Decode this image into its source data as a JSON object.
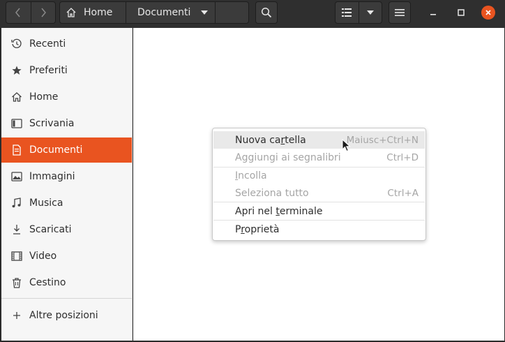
{
  "header": {
    "breadcrumb": {
      "home": "Home",
      "current": "Documenti"
    },
    "icons": {
      "back": "chevron-left-icon",
      "forward": "chevron-right-icon",
      "home": "home-icon",
      "search": "search-icon",
      "list_view": "list-view-icon",
      "view_options": "chevron-down-icon",
      "menu": "hamburger-icon",
      "minimize": "minimize-icon",
      "maximize": "maximize-icon",
      "close": "close-icon"
    },
    "accent": "#e95420"
  },
  "sidebar": {
    "items": [
      {
        "label": "Recenti",
        "icon": "clock-icon"
      },
      {
        "label": "Preferiti",
        "icon": "star-icon"
      },
      {
        "label": "Home",
        "icon": "home-icon"
      },
      {
        "label": "Scrivania",
        "icon": "desktop-icon"
      },
      {
        "label": "Documenti",
        "icon": "document-icon",
        "active": true
      },
      {
        "label": "Immagini",
        "icon": "image-icon"
      },
      {
        "label": "Musica",
        "icon": "music-icon"
      },
      {
        "label": "Scaricati",
        "icon": "download-icon"
      },
      {
        "label": "Video",
        "icon": "video-icon"
      },
      {
        "label": "Cestino",
        "icon": "trash-icon"
      }
    ],
    "other": {
      "label": "Altre posizioni",
      "icon": "plus-icon"
    }
  },
  "context_menu": {
    "items": [
      {
        "pre": "Nuova ca",
        "mn": "r",
        "post": "tella",
        "accel": "Maiusc+Ctrl+N",
        "enabled": true,
        "hover": true
      },
      {
        "pre": "Aggiungi ai segnalibri",
        "mn": "",
        "post": "",
        "accel": "Ctrl+D",
        "enabled": false
      },
      {
        "pre": "",
        "mn": "I",
        "post": "ncolla",
        "accel": "",
        "enabled": false
      },
      {
        "pre": "Seleziona tutto",
        "mn": "",
        "post": "",
        "accel": "Ctrl+A",
        "enabled": false
      },
      {
        "pre": "Apri nel ",
        "mn": "t",
        "post": "erminale",
        "accel": "",
        "enabled": true
      },
      {
        "pre": "P",
        "mn": "r",
        "post": "oprietà",
        "accel": "",
        "enabled": true
      }
    ]
  }
}
